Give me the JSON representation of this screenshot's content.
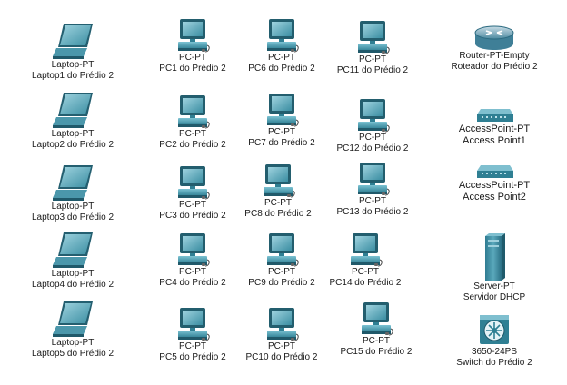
{
  "devices": {
    "laptops": [
      {
        "type": "Laptop-PT",
        "name": "Laptop1 do Prédio 2"
      },
      {
        "type": "Laptop-PT",
        "name": "Laptop2 do Prédio 2"
      },
      {
        "type": "Laptop-PT",
        "name": "Laptop3 do Prédio 2"
      },
      {
        "type": "Laptop-PT",
        "name": "Laptop4 do Prédio 2"
      },
      {
        "type": "Laptop-PT",
        "name": "Laptop5 do Prédio 2"
      }
    ],
    "pcs": [
      {
        "type": "PC-PT",
        "name": "PC1 do Prédio 2"
      },
      {
        "type": "PC-PT",
        "name": "PC2 do Prédio 2"
      },
      {
        "type": "PC-PT",
        "name": "PC3 do Prédio 2"
      },
      {
        "type": "PC-PT",
        "name": "PC4 do Prédio 2"
      },
      {
        "type": "PC-PT",
        "name": "PC5 do Prédio 2"
      },
      {
        "type": "PC-PT",
        "name": "PC6 do Prédio 2"
      },
      {
        "type": "PC-PT",
        "name": "PC7 do Prédio 2"
      },
      {
        "type": "PC-PT",
        "name": "PC8 do Prédio 2"
      },
      {
        "type": "PC-PT",
        "name": "PC9 do Prédio 2"
      },
      {
        "type": "PC-PT",
        "name": "PC10 do Prédio 2"
      },
      {
        "type": "PC-PT",
        "name": "PC11 do Prédio 2"
      },
      {
        "type": "PC-PT",
        "name": "PC12 do Prédio 2"
      },
      {
        "type": "PC-PT",
        "name": "PC13 do Prédio 2"
      },
      {
        "type": "PC-PT",
        "name": "PC14 do Prédio 2"
      },
      {
        "type": "PC-PT",
        "name": "PC15 do Prédio 2"
      }
    ],
    "router": {
      "type": "Router-PT-Empty",
      "name": "Roteador do Prédio 2"
    },
    "access_points": [
      {
        "type": "AccessPoint-PT",
        "name": "Access Point1"
      },
      {
        "type": "AccessPoint-PT",
        "name": "Access Point2"
      }
    ],
    "server": {
      "type": "Server-PT",
      "name": "Servidor DHCP"
    },
    "switch": {
      "type": "3650-24PS",
      "name": "Switch do Prédio 2"
    }
  },
  "icons": {
    "laptop": "laptop-icon",
    "pc": "pc-icon",
    "router": "router-icon",
    "access_point": "access-point-icon",
    "server": "server-icon",
    "switch": "multilayer-switch-icon"
  },
  "colors": {
    "device_teal": "#3e8fa3",
    "device_dark": "#235e6e",
    "screen": "#6fb6c7",
    "background": "#ffffff"
  }
}
